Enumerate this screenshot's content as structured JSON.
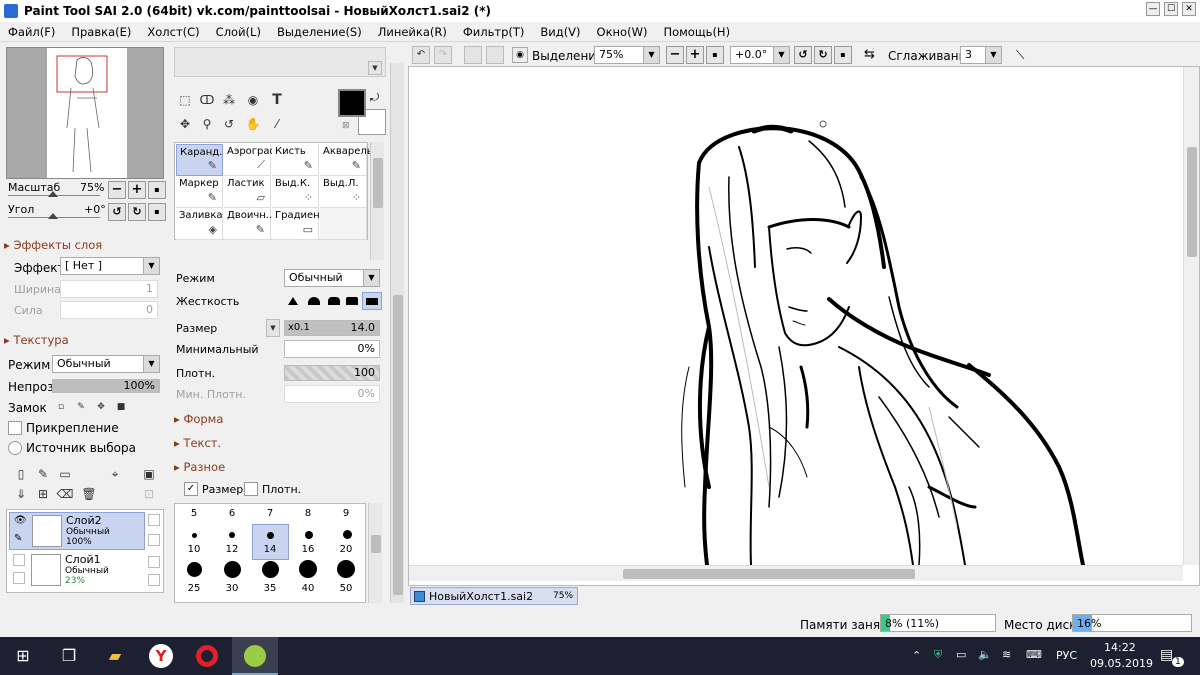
{
  "window": {
    "title": "Paint Tool SAI 2.0 (64bit) vk.com/painttoolsai - НовыйХолст1.sai2 (*)",
    "min": "—",
    "max": "☐",
    "close": "✕"
  },
  "menu": [
    "Файл(F)",
    "Правка(E)",
    "Холст(C)",
    "Слой(L)",
    "Выделение(S)",
    "Линейка(R)",
    "Фильтр(T)",
    "Вид(V)",
    "Окно(W)",
    "Помощь(H)"
  ],
  "navigator": {
    "zoom_label": "Масштаб",
    "zoom_value": "75%",
    "angle_label": "Угол",
    "angle_value": "+0°",
    "zoom_out": "−",
    "zoom_in": "+",
    "zoom_reset": "▪",
    "rot_ccw": "↺",
    "rot_cw": "↻",
    "rot_reset": "▪"
  },
  "layer_effects": {
    "section": "Эффекты слоя",
    "effect_label": "Эффект",
    "effect_value": "[ Нет ]",
    "width_label": "Ширина",
    "width_value": "1",
    "strength_label": "Сила",
    "strength_value": "0"
  },
  "texture": {
    "section": "Текстура"
  },
  "layer_props": {
    "mode_label": "Режим",
    "mode_value": "Обычный",
    "opacity_label": "Непроз.",
    "opacity_value": "100%",
    "lock_label": "Замок",
    "clip_label": "Прикрепление",
    "selsource_label": "Источник выбора"
  },
  "layers": [
    {
      "name": "Слой2",
      "mode": "Обычный",
      "opacity": "100%",
      "selected": true
    },
    {
      "name": "Слой1",
      "mode": "Обычный",
      "opacity": "23%",
      "selected": false
    }
  ],
  "tools": {
    "text_tool": "T"
  },
  "brushes": [
    {
      "name": "Каранд.",
      "icon": "pencil-icon",
      "glyph": "✎",
      "selected": true
    },
    {
      "name": "Аэрограф",
      "icon": "airbrush-icon",
      "glyph": "⟋",
      "selected": false
    },
    {
      "name": "Кисть",
      "icon": "brush-icon",
      "glyph": "✎",
      "selected": false
    },
    {
      "name": "Акварель",
      "icon": "watercolor-icon",
      "glyph": "✎",
      "selected": false
    },
    {
      "name": "Маркер",
      "icon": "marker-icon",
      "glyph": "✎",
      "selected": false
    },
    {
      "name": "Ластик",
      "icon": "eraser-icon",
      "glyph": "▱",
      "selected": false
    },
    {
      "name": "Выд.К.",
      "icon": "select-pen-icon",
      "glyph": "⁘",
      "selected": false
    },
    {
      "name": "Выд.Л.",
      "icon": "select-eraser-icon",
      "glyph": "⁘",
      "selected": false
    },
    {
      "name": "Заливка",
      "icon": "bucket-icon",
      "glyph": "◈",
      "selected": false
    },
    {
      "name": "Двоичн...",
      "icon": "binary-pen-icon",
      "glyph": "✎",
      "selected": false
    },
    {
      "name": "Градиент",
      "icon": "gradient-icon",
      "glyph": "▭",
      "selected": false
    },
    {
      "name": "",
      "icon": "",
      "glyph": "",
      "selected": false
    }
  ],
  "brush_settings": {
    "mode_label": "Режим",
    "mode_value": "Обычный",
    "hardness_label": "Жесткость",
    "size_label": "Размер",
    "size_mult": "x0.1",
    "size_value": "14.0",
    "minsize_label": "Минимальный",
    "minsize_value": "0%",
    "density_label": "Плотн.",
    "density_value": "100",
    "mindensity_label": "Мин. Плотн.",
    "mindensity_value": "0%",
    "shape_section": "Форма",
    "texture_section": "Текст.",
    "misc_section": "Разное",
    "size_check_label": "Размер",
    "density_check_label": "Плотн.",
    "check_mark": "✓"
  },
  "size_presets": {
    "row1": [
      "5",
      "6",
      "7",
      "8",
      "9"
    ],
    "row2": [
      "10",
      "12",
      "14",
      "16",
      "20"
    ],
    "row3": [
      "25",
      "30",
      "35",
      "40",
      "50"
    ],
    "selected": "14"
  },
  "toolbar": {
    "selection_label": "Выделение",
    "zoom_value": "75%",
    "zoom_out": "−",
    "zoom_in": "+",
    "zoom_reset": "▪",
    "angle_value": "+0.0°",
    "rot_ccw": "↺",
    "rot_cw": "↻",
    "rot_reset": "▪",
    "flip": "⇆",
    "smoothing_label": "Сглаживание",
    "smoothing_value": "3",
    "undo": "↶",
    "redo": "↷"
  },
  "canvas_tab": {
    "name": "НовыйХолст1.sai2",
    "zoom": "75%"
  },
  "status": {
    "memory_label": "Памяти занято",
    "memory_value": "8% (11%)",
    "memory_fraction": 0.08,
    "disk_label": "Место диска",
    "disk_value": "16%",
    "disk_fraction": 0.16
  },
  "taskbar": {
    "lang": "РУС",
    "time": "14:22",
    "date": "09.05.2019",
    "notify_count": "1"
  },
  "colors": {
    "primary": "#000000",
    "secondary": "#ffffff",
    "accent": "#c8d4f0",
    "section_text": "#8b3b1c",
    "taskbar": "#1c2030"
  }
}
